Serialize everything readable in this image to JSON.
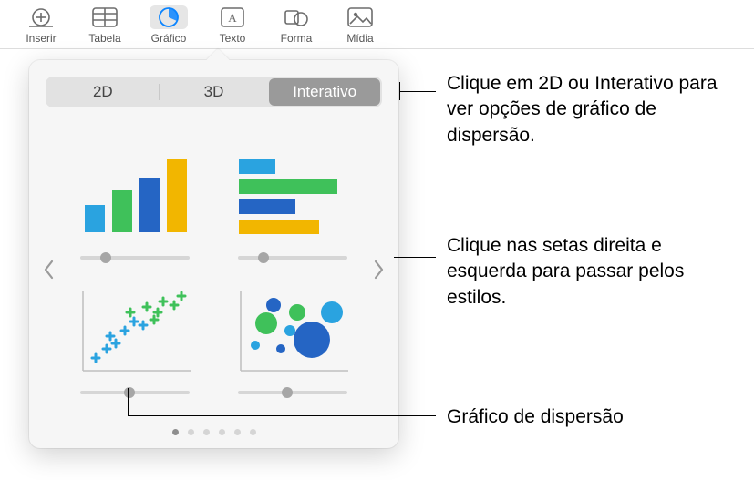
{
  "toolbar": {
    "insert": "Inserir",
    "table": "Tabela",
    "chart": "Gráfico",
    "text": "Texto",
    "shape": "Forma",
    "media": "Mídia"
  },
  "tabs": {
    "tab2d": "2D",
    "tab3d": "3D",
    "tabInteractive": "Interativo"
  },
  "icons": {
    "insert": "insert-icon",
    "table": "table-icon",
    "chart": "chart-icon",
    "text": "text-icon",
    "shape": "shape-icon",
    "media": "media-icon"
  },
  "callouts": {
    "c1": "Clique em 2D ou Interativo para ver opções de gráfico de dispersão.",
    "c2": "Clique nas setas direita e esquerda para passar pelos estilos.",
    "c3": "Gráfico de dispersão"
  }
}
